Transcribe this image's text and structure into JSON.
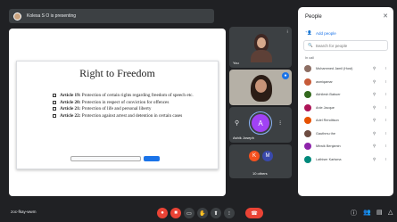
{
  "present_bar": {
    "text": "Kolesa S O is presenting"
  },
  "slide": {
    "title": "Right to Freedom",
    "items": [
      {
        "bold": "Article 19:",
        "text": " Protection of certain rights regarding freedom of speech etc."
      },
      {
        "bold": "Article 20:",
        "text": " Protection in respect of conviction for offences"
      },
      {
        "bold": "Article 21:",
        "text": " Protection of life and personal liberty"
      },
      {
        "bold": "Article 22:",
        "text": " Protection against arrest and detention in certain cases"
      }
    ]
  },
  "tiles": {
    "you_label": "You",
    "t3_avatar": "A",
    "t3_name": "Ashik Joseph",
    "t4_avatar_k": "K",
    "t4_avatar_m": "M",
    "t4_label": "10 others"
  },
  "panel": {
    "title": "People",
    "close_icon": "close-icon",
    "add_people": "Add people",
    "search_placeholder": "Search for people",
    "section_label": "In call",
    "people": [
      {
        "name": "Muhammed Jamil (Host)",
        "color": "#8d6e63",
        "initial": ""
      },
      {
        "name": "asmiqamar",
        "color": "#c75b39",
        "initial": ""
      },
      {
        "name": "Akhilesh Babuer",
        "color": "#33691e",
        "initial": ""
      },
      {
        "name": "Anle Jacque",
        "color": "#ad1457",
        "initial": ""
      },
      {
        "name": "Adel Renditson",
        "color": "#e65100",
        "initial": ""
      },
      {
        "name": "Gauthmu the",
        "color": "#6d4c41",
        "initial": ""
      },
      {
        "name": "Mhwik Benjamin",
        "color": "#8e24aa",
        "initial": ""
      },
      {
        "name": "Lathiser Karlsma",
        "color": "#00897b",
        "initial": ""
      }
    ]
  },
  "bottom": {
    "meeting_code": "zoc-fkay-wwm"
  },
  "colors": {
    "red": "#ea4335",
    "blue": "#1a73e8",
    "panel_bg": "#ffffff"
  }
}
